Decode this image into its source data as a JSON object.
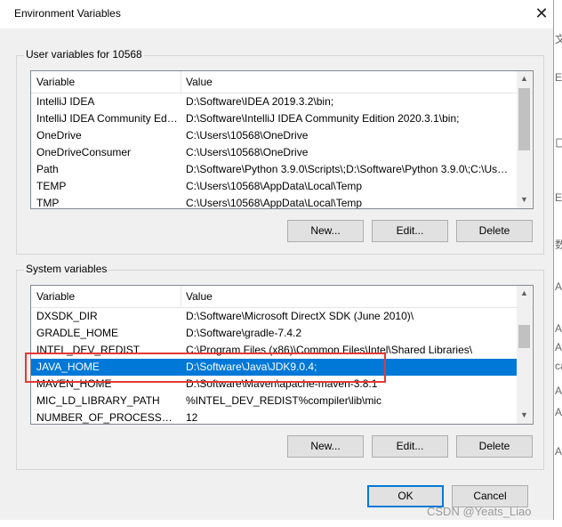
{
  "window": {
    "title": "Environment Variables",
    "close_glyph": "✕"
  },
  "user_group": {
    "label": "User variables for 10568",
    "columns": {
      "variable": "Variable",
      "value": "Value"
    },
    "rows": [
      {
        "variable": "IntelliJ IDEA",
        "value": "D:\\Software\\IDEA 2019.3.2\\bin;"
      },
      {
        "variable": "IntelliJ IDEA Community Edit...",
        "value": "D:\\Software\\IntelliJ IDEA Community Edition 2020.3.1\\bin;"
      },
      {
        "variable": "OneDrive",
        "value": "C:\\Users\\10568\\OneDrive"
      },
      {
        "variable": "OneDriveConsumer",
        "value": "C:\\Users\\10568\\OneDrive"
      },
      {
        "variable": "Path",
        "value": "D:\\Software\\Python 3.9.0\\Scripts\\;D:\\Software\\Python 3.9.0\\;C:\\Use..."
      },
      {
        "variable": "TEMP",
        "value": "C:\\Users\\10568\\AppData\\Local\\Temp"
      },
      {
        "variable": "TMP",
        "value": "C:\\Users\\10568\\AppData\\Local\\Temp"
      }
    ],
    "buttons": {
      "new": "New...",
      "edit": "Edit...",
      "delete": "Delete"
    }
  },
  "system_group": {
    "label": "System variables",
    "columns": {
      "variable": "Variable",
      "value": "Value"
    },
    "rows": [
      {
        "variable": "DXSDK_DIR",
        "value": "D:\\Software\\Microsoft DirectX SDK (June 2010)\\"
      },
      {
        "variable": "GRADLE_HOME",
        "value": "D:\\Software\\gradle-7.4.2"
      },
      {
        "variable": "INTEL_DEV_REDIST",
        "value": "C:\\Program Files (x86)\\Common Files\\Intel\\Shared Libraries\\"
      },
      {
        "variable": "JAVA_HOME",
        "value": "D:\\Software\\Java\\JDK9.0.4;"
      },
      {
        "variable": "MAVEN_HOME",
        "value": "D:\\Software\\Maven\\apache-maven-3.8.1"
      },
      {
        "variable": "MIC_LD_LIBRARY_PATH",
        "value": "%INTEL_DEV_REDIST%compiler\\lib\\mic"
      },
      {
        "variable": "NUMBER_OF_PROCESSORS",
        "value": "12"
      }
    ],
    "selected_variable": "JAVA_HOME",
    "buttons": {
      "new": "New...",
      "edit": "Edit...",
      "delete": "Delete"
    }
  },
  "footer": {
    "ok": "OK",
    "cancel": "Cancel"
  },
  "background_fragments": [
    "文",
    "E",
    "匚",
    "E",
    "数",
    "A",
    "A",
    "A",
    "ca",
    "A",
    "A",
    "A"
  ],
  "watermark": "CSDN @Yeats_Liao",
  "colors": {
    "selection": "#0078d7",
    "highlight_border": "#e53935",
    "default_button_border": "#0078d7"
  }
}
